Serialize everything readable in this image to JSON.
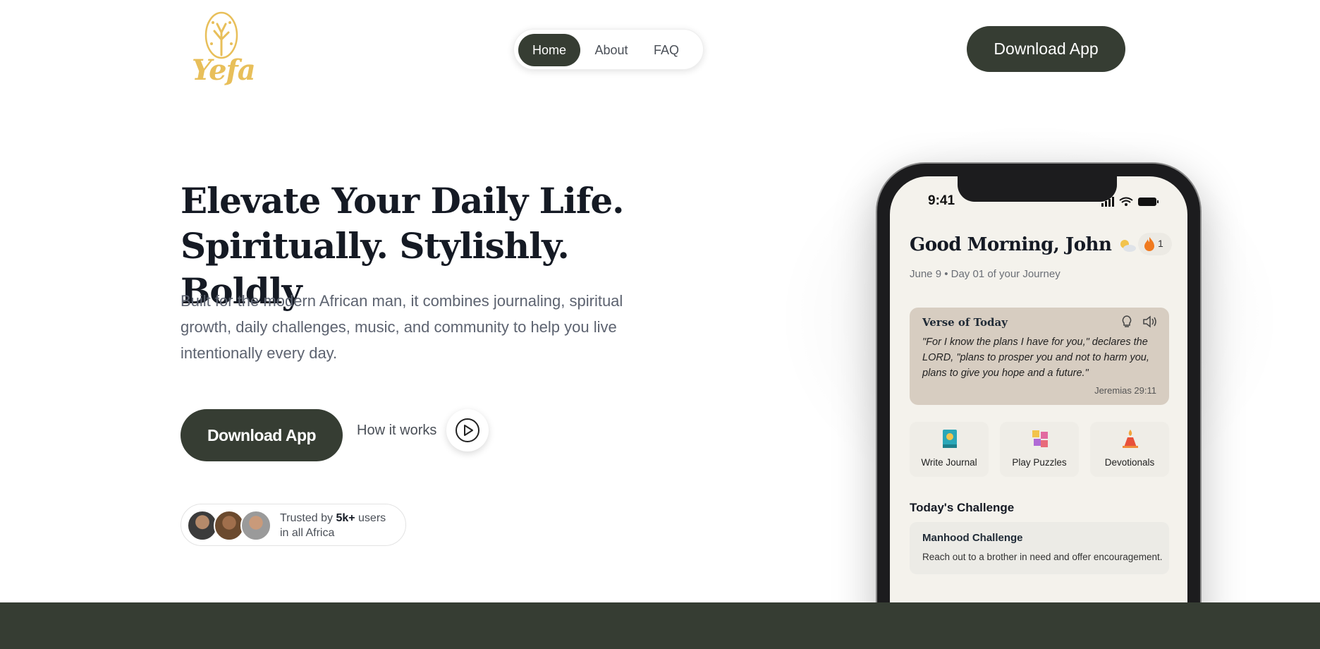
{
  "brand": {
    "name": "Yefa",
    "logo_color": "#e8bf5a"
  },
  "nav": {
    "items": [
      "Home",
      "About",
      "FAQ"
    ],
    "active": "Home"
  },
  "header": {
    "download_label": "Download App"
  },
  "hero": {
    "title_line1": "Elevate Your Daily Life.",
    "title_line2": "Spiritually. Stylishly. Boldly",
    "subtitle": "Built for the modern African man, it combines journaling, spiritual growth, daily challenges, music, and community to help you live intentionally every day.",
    "download_label": "Download App",
    "how_label": "How it works"
  },
  "trust": {
    "prefix": "Trusted by ",
    "count": "5k+",
    "suffix": " users",
    "line2": "in all Africa"
  },
  "phone": {
    "time": "9:41",
    "greeting": "Good Morning, John",
    "streak": "1",
    "date_line": "June 9 • Day 01 of your Journey",
    "verse": {
      "title": "Verse of Today",
      "text": "\"For I know the plans I have for you,\" declares the LORD, \"plans to prosper you and not to harm you, plans to give you hope and a future.\"",
      "ref": "Jeremias 29:11"
    },
    "actions": [
      "Write Journal",
      "Play Puzzles",
      "Devotionals"
    ],
    "challenge_section": "Today's Challenge",
    "challenge_title": "Manhood Challenge",
    "challenge_text": "Reach out to a brother in need and offer encouragement."
  },
  "colors": {
    "accent_dark": "#363d33",
    "text_dark": "#151a24",
    "muted": "#5d6370"
  }
}
